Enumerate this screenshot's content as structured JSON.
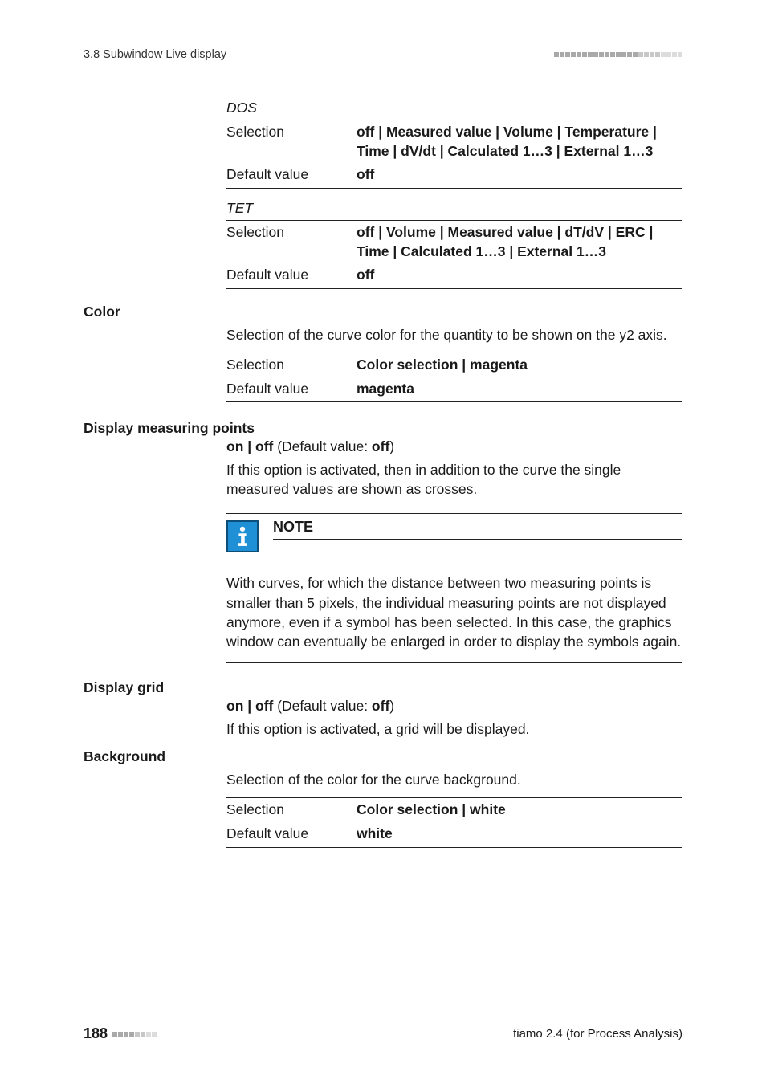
{
  "header": {
    "section": "3.8 Subwindow Live display"
  },
  "dos": {
    "title": "DOS",
    "rows": [
      {
        "key": "Selection",
        "val": "off | Measured value | Volume | Temperature | Time | dV/dt | Calculated 1…3 | External 1…3"
      },
      {
        "key": "Default value",
        "val": "off"
      }
    ]
  },
  "tet": {
    "title": "TET",
    "rows": [
      {
        "key": "Selection",
        "val": "off | Volume | Measured value | dT/dV | ERC | Time | Calculated 1…3 | External 1…3"
      },
      {
        "key": "Default value",
        "val": "off"
      }
    ]
  },
  "color": {
    "label": "Color",
    "para": "Selection of the curve color for the quantity to be shown on the y2 axis.",
    "rows": [
      {
        "key": "Selection",
        "val": "Color selection | magenta"
      },
      {
        "key": "Default value",
        "val": "magenta"
      }
    ]
  },
  "display_points": {
    "label": "Display measuring points",
    "onoff_prefix": "on | off",
    "onoff_mid": " (Default value: ",
    "onoff_bold": "off",
    "onoff_suffix": ")",
    "para": "If this option is activated, then in addition to the curve the single measured values are shown as crosses."
  },
  "note": {
    "title": "NOTE",
    "body": "With curves, for which the distance between two measuring points is smaller than 5 pixels, the individual measuring points are not displayed anymore, even if a symbol has been selected. In this case, the graphics window can eventually be enlarged in order to display the symbols again."
  },
  "display_grid": {
    "label": "Display grid",
    "onoff_prefix": "on | off",
    "onoff_mid": " (Default value: ",
    "onoff_bold": "off",
    "onoff_suffix": ")",
    "para": "If this option is activated, a grid will be displayed."
  },
  "background": {
    "label": "Background",
    "para": "Selection of the color for the curve background.",
    "rows": [
      {
        "key": "Selection",
        "val": "Color selection | white"
      },
      {
        "key": "Default value",
        "val": "white"
      }
    ]
  },
  "footer": {
    "page": "188",
    "right": "tiamo 2.4 (for Process Analysis)"
  }
}
